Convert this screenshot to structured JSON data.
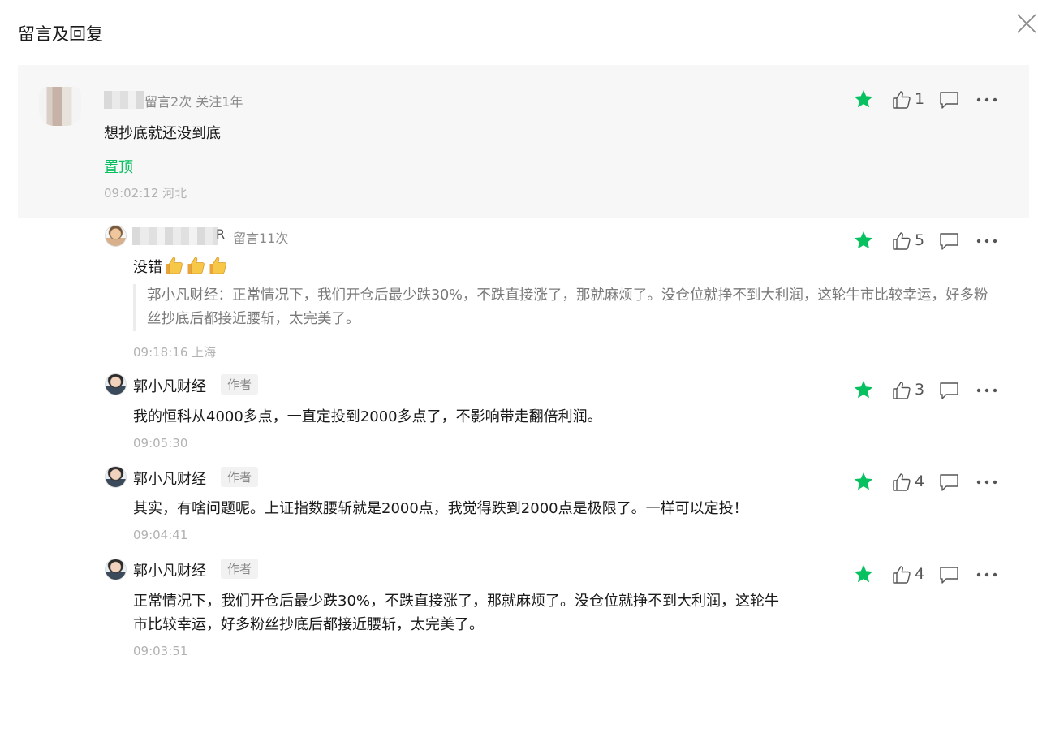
{
  "dialog": {
    "title": "留言及回复",
    "close_icon": "close-icon"
  },
  "accent_color": "#07c160",
  "top_comment": {
    "meta": "留言2次 关注1年",
    "content": "想抄底就还没到底",
    "pin_label": "置顶",
    "time": "09:02:12 河北",
    "likes": "1"
  },
  "replies": [
    {
      "name_suffix": "R",
      "meta": "留言11次",
      "content": "没错",
      "emoji": "thumbs-up-emoji",
      "quote": "郭小凡财经：正常情况下，我们开仓后最少跌30%，不跌直接涨了，那就麻烦了。没仓位就挣不到大利润，这轮牛市比较幸运，好多粉丝抄底后都接近腰斩，太完美了。",
      "time": "09:18:16 上海",
      "likes": "5"
    },
    {
      "name": "郭小凡财经",
      "badge": "作者",
      "content": "我的恒科从4000多点，一直定投到2000多点了，不影响带走翻倍利润。",
      "time": "09:05:30",
      "likes": "3"
    },
    {
      "name": "郭小凡财经",
      "badge": "作者",
      "content": "其实，有啥问题呢。上证指数腰斩就是2000点，我觉得跌到2000点是极限了。一样可以定投！",
      "time": "09:04:41",
      "likes": "4"
    },
    {
      "name": "郭小凡财经",
      "badge": "作者",
      "content_line1": "正常情况下，我们开仓后最少跌30%，不跌直接涨了，那就麻烦了。没仓位就挣不到大利润，这轮牛",
      "content_line2": "市比较幸运，好多粉丝抄底后都接近腰斩，太完美了。",
      "time": "09:03:51",
      "likes": "4"
    }
  ]
}
